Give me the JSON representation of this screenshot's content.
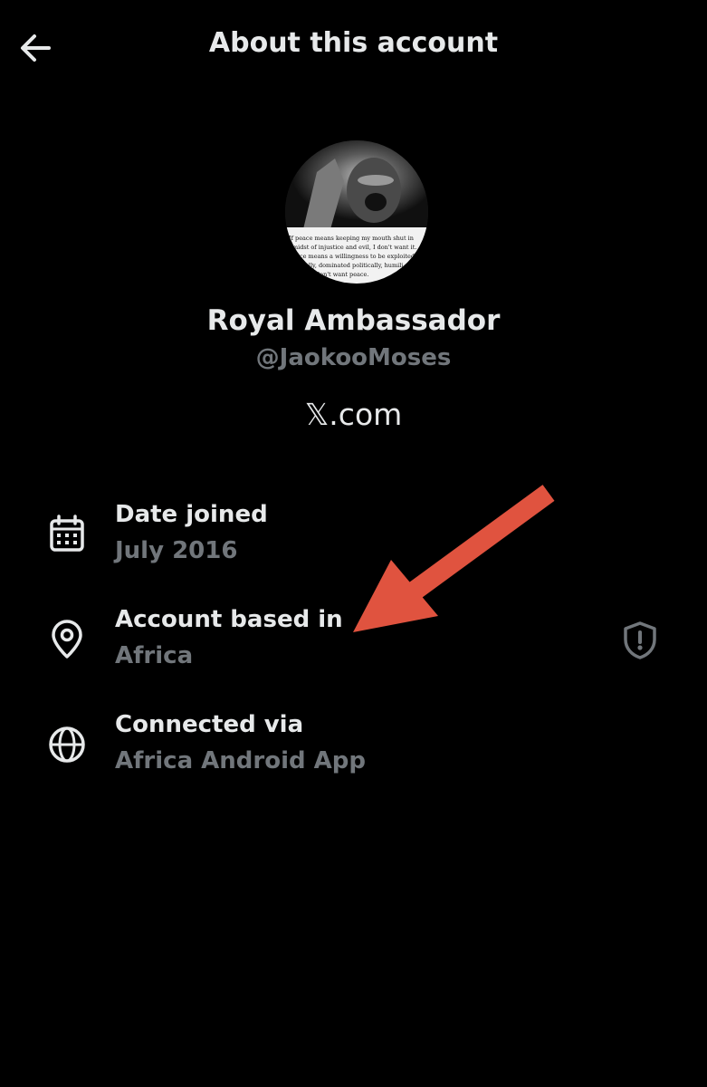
{
  "header": {
    "title": "About this account",
    "back_icon": "arrow-left-icon"
  },
  "profile": {
    "display_name": "Royal Ambassador",
    "handle": "@JaokooMoses",
    "site": "𝕏.com",
    "avatar_quote": [
      "If peace means keeping my mouth shut in",
      "midst of injustice and evil, I don't want it.",
      "ce means a willingness to be exploited",
      "ally, dominated politically, humili",
      "don't want peace."
    ]
  },
  "details": {
    "date_joined": {
      "label": "Date joined",
      "value": "July 2016",
      "icon": "calendar-icon"
    },
    "based_in": {
      "label": "Account based in",
      "value": "Africa",
      "icon": "location-pin-icon",
      "badge_icon": "shield-alert-icon"
    },
    "connected": {
      "label": "Connected via",
      "value": "Africa Android App",
      "icon": "globe-icon"
    }
  },
  "colors": {
    "background": "#000000",
    "primary_text": "#e7e9ea",
    "secondary_text": "#71767b",
    "annotation_arrow": "#e0533f"
  }
}
